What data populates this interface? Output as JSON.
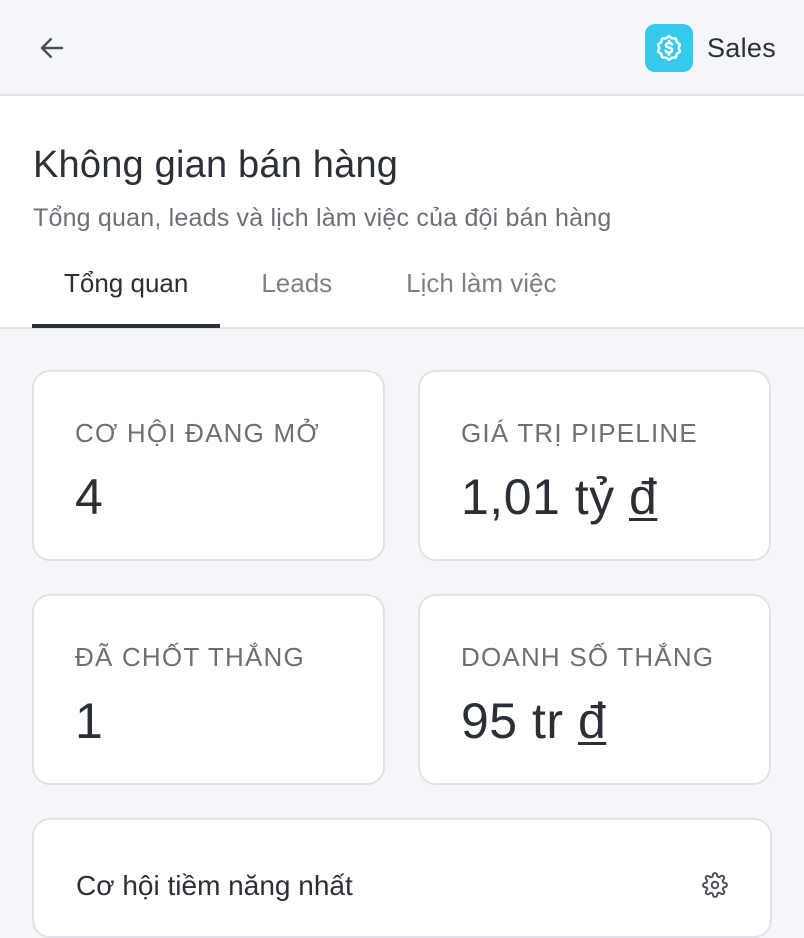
{
  "app": {
    "name": "Sales",
    "brand_color": "#35c9ec",
    "logo_icon": "dollar-coin-icon",
    "back_icon": "arrow-left-icon"
  },
  "header": {
    "title": "Không gian bán hàng",
    "subtitle": "Tổng quan, leads và lịch làm việc của đội bán hàng"
  },
  "tabs": [
    {
      "label": "Tổng quan",
      "active": true
    },
    {
      "label": "Leads",
      "active": false
    },
    {
      "label": "Lịch làm việc",
      "active": false
    }
  ],
  "stats": [
    {
      "label": "CƠ HỘI ĐANG MỞ",
      "value": "4",
      "currency": ""
    },
    {
      "label": "GIÁ TRỊ PIPELINE",
      "value": "1,01 tỷ ",
      "currency": "đ"
    },
    {
      "label": "ĐÃ CHỐT THẮNG",
      "value": "1",
      "currency": ""
    },
    {
      "label": "DOANH SỐ THẮNG",
      "value": "95 tr ",
      "currency": "đ"
    }
  ],
  "panel": {
    "title": "Cơ hội tiềm năng nhất",
    "settings_icon": "gear-icon"
  }
}
